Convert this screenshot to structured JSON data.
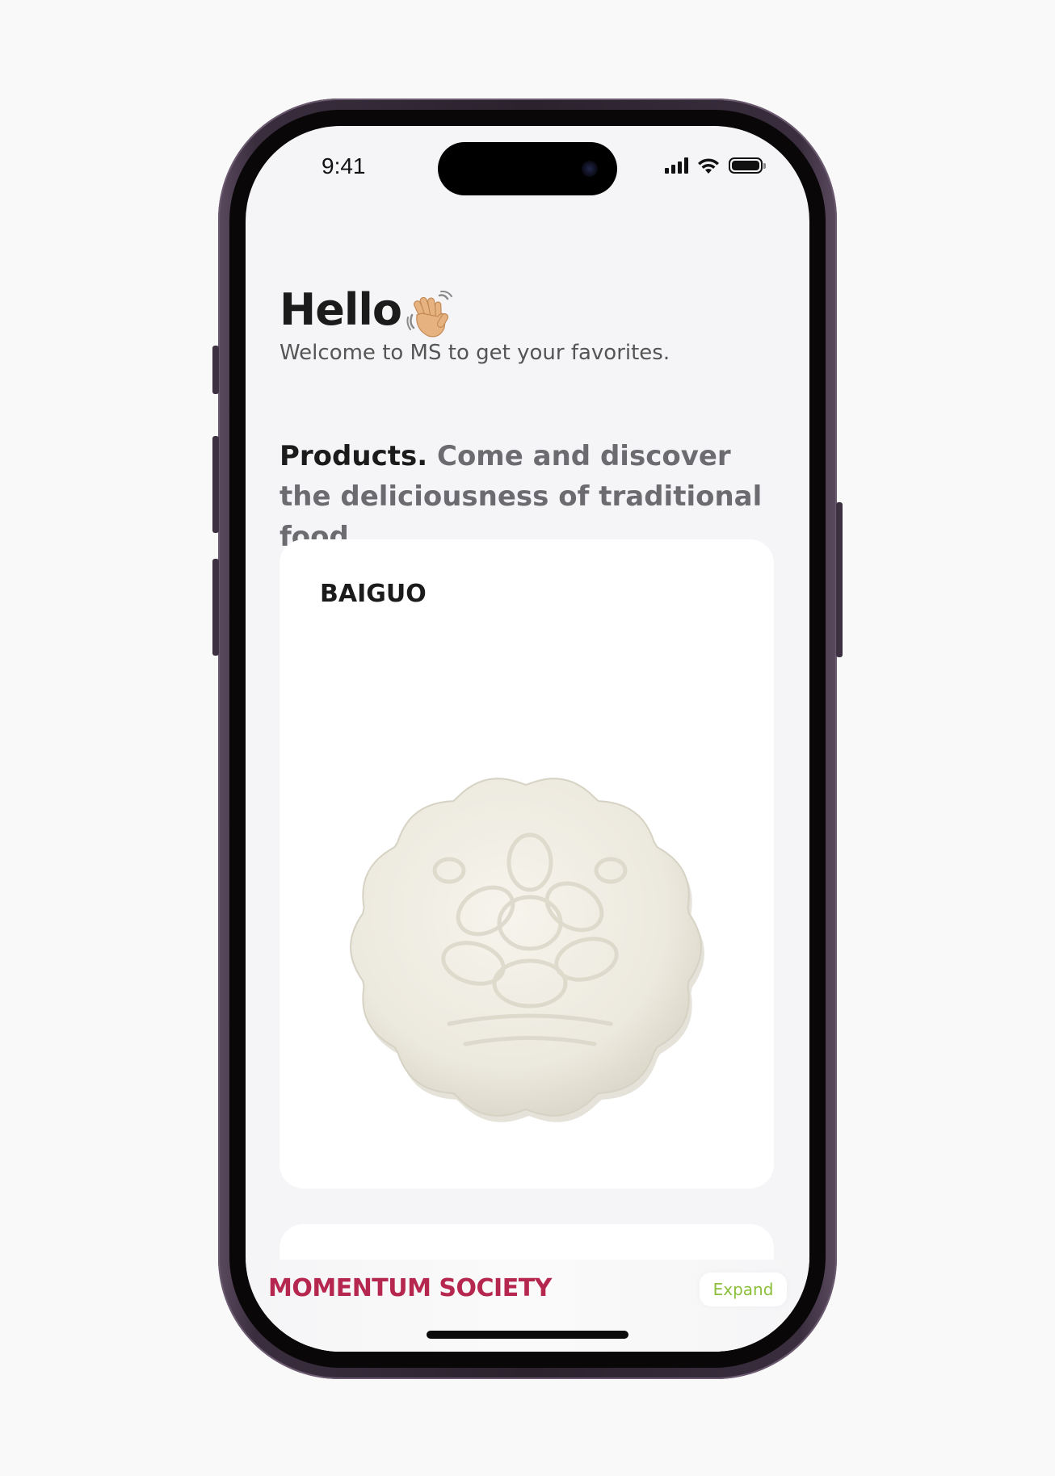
{
  "status_bar": {
    "time": "9:41"
  },
  "greeting": {
    "title": "Hello",
    "wave_icon": "waving-hand-icon",
    "subtitle": "Welcome to MS to get your favorites."
  },
  "products_section": {
    "heading_strong": "Products.",
    "heading_rest": "Come and discover the deliciousness of traditional food."
  },
  "product_cards": [
    {
      "name": "BAIGUO",
      "image": "mooncake-image"
    }
  ],
  "bottom_bar": {
    "brand": "MOMENTUM SOCIETY",
    "expand_label": "Expand"
  },
  "colors": {
    "brand": "#b5274e",
    "expand_text": "#8cbf3c",
    "screen_bg": "#f5f5f7"
  }
}
